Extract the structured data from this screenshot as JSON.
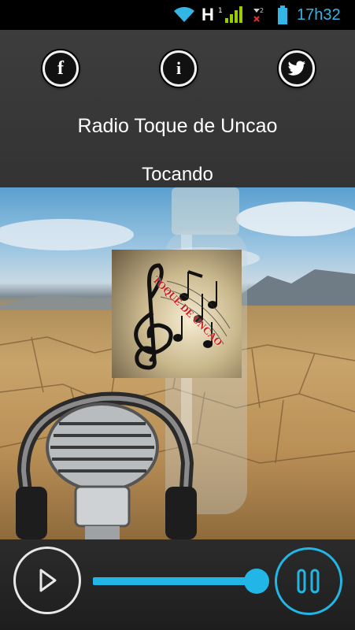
{
  "status_bar": {
    "network_type": "H",
    "time": "17h32",
    "icons": [
      "wifi-icon",
      "signal-icon",
      "sim2-no-signal-icon",
      "battery-icon"
    ]
  },
  "header": {
    "buttons": [
      {
        "name": "facebook-button",
        "icon": "facebook-icon",
        "glyph": "f"
      },
      {
        "name": "info-button",
        "icon": "info-icon",
        "glyph": "i"
      },
      {
        "name": "twitter-button",
        "icon": "twitter-icon"
      }
    ],
    "station_title": "Radio Toque de Uncao",
    "playing_status": "Tocando"
  },
  "artwork": {
    "logo_text": "TOQUE DE UNCAO"
  },
  "player": {
    "volume_level": 0.99,
    "play_icon": "play-icon",
    "pause_icon": "pause-icon"
  },
  "colors": {
    "accent": "#22b6e6",
    "status_time": "#33b5e5",
    "background": "#3a3a3a"
  }
}
